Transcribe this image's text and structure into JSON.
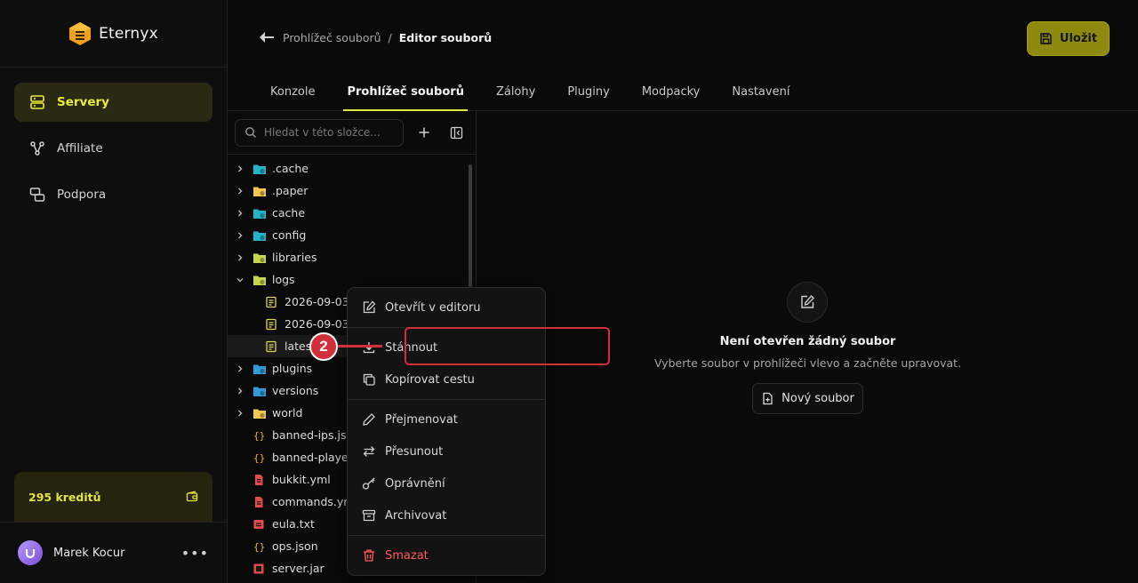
{
  "brand": {
    "name": "Eternyx"
  },
  "sidebar": {
    "items": [
      {
        "label": "Servery",
        "icon": "server-icon",
        "active": true
      },
      {
        "label": "Affiliate",
        "icon": "affiliate-icon",
        "active": false
      },
      {
        "label": "Podpora",
        "icon": "support-icon",
        "active": false
      }
    ],
    "credits": "295 kreditů",
    "user": "Marek Kocur"
  },
  "header": {
    "breadcrumb_parent": "Prohlížeč souborů",
    "breadcrumb_sep": "/",
    "breadcrumb_current": "Editor souborů",
    "save_label": "Uložit",
    "tabs": [
      "Konzole",
      "Prohlížeč souborů",
      "Zálohy",
      "Pluginy",
      "Modpacky",
      "Nastavení"
    ],
    "active_tab": 1
  },
  "filebrowser": {
    "search_placeholder": "Hledat v této složce...",
    "rows": [
      {
        "name": ".cache",
        "type": "folder",
        "expanded": false
      },
      {
        "name": ".paper",
        "type": "folder",
        "expanded": false
      },
      {
        "name": "cache",
        "type": "folder",
        "expanded": false
      },
      {
        "name": "config",
        "type": "folder",
        "expanded": false
      },
      {
        "name": "libraries",
        "type": "folder",
        "expanded": false
      },
      {
        "name": "logs",
        "type": "folder",
        "expanded": true
      },
      {
        "name": "2026-09-03-",
        "type": "log",
        "child": true
      },
      {
        "name": "2026-09-03-",
        "type": "log",
        "child": true
      },
      {
        "name": "latest",
        "type": "log",
        "child": true
      },
      {
        "name": "plugins",
        "type": "folder",
        "expanded": false
      },
      {
        "name": "versions",
        "type": "folder",
        "expanded": false
      },
      {
        "name": "world",
        "type": "folder",
        "expanded": false
      },
      {
        "name": "banned-ips.json",
        "type": "json"
      },
      {
        "name": "banned-player",
        "type": "json"
      },
      {
        "name": "bukkit.yml",
        "type": "yml"
      },
      {
        "name": "commands.ym",
        "type": "yml"
      },
      {
        "name": "eula.txt",
        "type": "txt"
      },
      {
        "name": "ops.json",
        "type": "json"
      },
      {
        "name": "server.jar",
        "type": "jar"
      }
    ]
  },
  "editor": {
    "empty_title": "Není otevřen žádný soubor",
    "empty_subtitle": "Vyberte soubor v prohlížeči vlevo a začněte upravovat.",
    "new_file_label": "Nový soubor"
  },
  "context_menu": {
    "items": [
      {
        "label": "Otevřít v editoru",
        "icon": "edit-icon"
      },
      {
        "label": "Stáhnout",
        "icon": "download-icon"
      },
      {
        "label": "Kopírovat cestu",
        "icon": "copy-icon"
      },
      {
        "label": "Přejmenovat",
        "icon": "pencil-icon"
      },
      {
        "label": "Přesunout",
        "icon": "move-icon"
      },
      {
        "label": "Oprávnění",
        "icon": "key-icon"
      },
      {
        "label": "Archivovat",
        "icon": "archive-icon"
      },
      {
        "label": "Smazat",
        "icon": "trash-icon"
      }
    ]
  },
  "annotation": {
    "badge": "2"
  },
  "colors": {
    "accent": "#e6e63a",
    "danger": "#ff5a5a",
    "annotation": "#d32f3a"
  }
}
